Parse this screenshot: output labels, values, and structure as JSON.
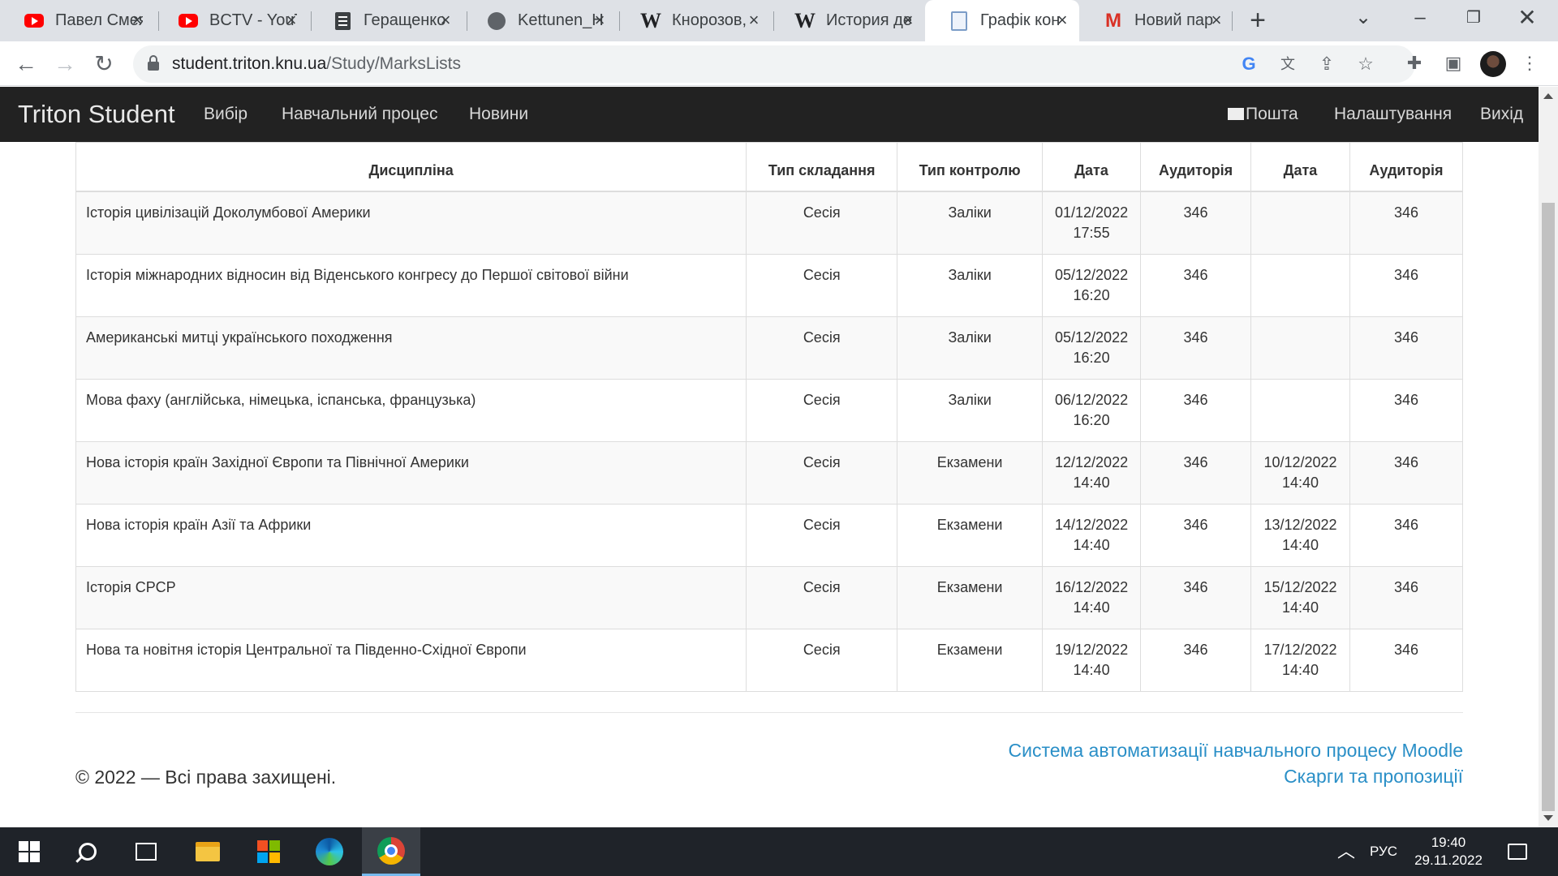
{
  "browser": {
    "tabs": [
      {
        "title": "Павел Смеян",
        "icon": "youtube-icon"
      },
      {
        "title": "BCTV - YouTube",
        "icon": "youtube-icon"
      },
      {
        "title": "Геращенко",
        "icon": "document-icon"
      },
      {
        "title": "Kettunen_H",
        "icon": "globe-icon"
      },
      {
        "title": "Кнорозов,",
        "icon": "wikipedia-icon"
      },
      {
        "title": "История де",
        "icon": "wikipedia-icon"
      },
      {
        "title": "Графік кон",
        "icon": "page-icon",
        "active": true
      },
      {
        "title": "Новий пар",
        "icon": "gmail-icon"
      }
    ],
    "url_host": "student.triton.knu.ua",
    "url_path": "/Study/MarksLists"
  },
  "navbar": {
    "brand": "Triton Student",
    "left_links": [
      "Вибір",
      "Навчальний процес",
      "Новини"
    ],
    "right_links": [
      "Пошта",
      "Налаштування",
      "Вихід"
    ]
  },
  "table": {
    "headers": [
      "Дисципліна",
      "Тип складання",
      "Тип контролю",
      "Дата",
      "Аудиторія",
      "Дата",
      "Аудиторія"
    ],
    "rows": [
      {
        "discipline": "Історія цивілізацій Доколумбової Америки",
        "assessment_type": "Сесія",
        "control_type": "Заліки",
        "date1": "01/12/2022",
        "time1": "17:55",
        "room1": "346",
        "date2": "",
        "time2": "",
        "room2": "346"
      },
      {
        "discipline": "Історія міжнародних відносин від Віденського конгресу до Першої світової війни",
        "assessment_type": "Сесія",
        "control_type": "Заліки",
        "date1": "05/12/2022",
        "time1": "16:20",
        "room1": "346",
        "date2": "",
        "time2": "",
        "room2": "346"
      },
      {
        "discipline": "Американські митці українського походження",
        "assessment_type": "Сесія",
        "control_type": "Заліки",
        "date1": "05/12/2022",
        "time1": "16:20",
        "room1": "346",
        "date2": "",
        "time2": "",
        "room2": "346"
      },
      {
        "discipline": "Мова фаху (англійська, німецька, іспанська, французька)",
        "assessment_type": "Сесія",
        "control_type": "Заліки",
        "date1": "06/12/2022",
        "time1": "16:20",
        "room1": "346",
        "date2": "",
        "time2": "",
        "room2": "346"
      },
      {
        "discipline": "Нова історія країн Західної Європи та Північної Америки",
        "assessment_type": "Сесія",
        "control_type": "Екзамени",
        "date1": "12/12/2022",
        "time1": "14:40",
        "room1": "346",
        "date2": "10/12/2022",
        "time2": "14:40",
        "room2": "346"
      },
      {
        "discipline": "Нова історія країн Азії та Африки",
        "assessment_type": "Сесія",
        "control_type": "Екзамени",
        "date1": "14/12/2022",
        "time1": "14:40",
        "room1": "346",
        "date2": "13/12/2022",
        "time2": "14:40",
        "room2": "346"
      },
      {
        "discipline": "Історія СРСР",
        "assessment_type": "Сесія",
        "control_type": "Екзамени",
        "date1": "16/12/2022",
        "time1": "14:40",
        "room1": "346",
        "date2": "15/12/2022",
        "time2": "14:40",
        "room2": "346"
      },
      {
        "discipline": "Нова та новітня історія Центральної та Південно-Східної Європи",
        "assessment_type": "Сесія",
        "control_type": "Екзамени",
        "date1": "19/12/2022",
        "time1": "14:40",
        "room1": "346",
        "date2": "17/12/2022",
        "time2": "14:40",
        "room2": "346"
      }
    ]
  },
  "footer": {
    "copyright": "© 2022 — Всі права захищені.",
    "links": [
      "Система автоматизації навчального процесу Moodle",
      "Скарги та пропозиції"
    ],
    "link_color": "#2a8fc7"
  },
  "taskbar": {
    "language": "РУС",
    "time": "19:40",
    "date": "29.11.2022"
  }
}
